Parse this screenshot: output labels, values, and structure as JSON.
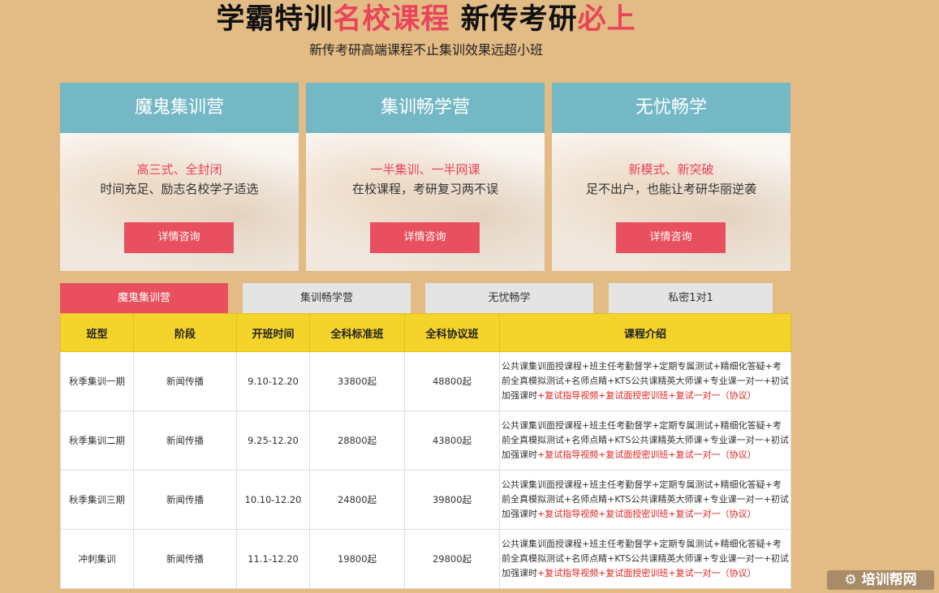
{
  "header": {
    "title_part1": "学霸特训",
    "title_part2": "名校课程",
    "title_part3": " 新传考研",
    "title_part4": "必上",
    "subtitle": "新传考研高端课程不止集训效果远超小班"
  },
  "cards": [
    {
      "title": "魔鬼集训营",
      "line1": "高三式、全封闭",
      "line2": "时间充足、励志名校学子适选",
      "button": "详情咨询"
    },
    {
      "title": "集训畅学营",
      "line1": "一半集训、一半网课",
      "line2": "在校课程，考研复习两不误",
      "button": "详情咨询"
    },
    {
      "title": "无忧畅学",
      "line1": "新模式、新突破",
      "line2": "足不出户，也能让考研华丽逆袭",
      "button": "详情咨询"
    }
  ],
  "tabs": [
    {
      "label": "魔鬼集训营",
      "active": true
    },
    {
      "label": "集训畅学营",
      "active": false
    },
    {
      "label": "无忧畅学",
      "active": false
    },
    {
      "label": "私密1对1",
      "active": false
    }
  ],
  "table": {
    "headers": [
      "班型",
      "阶段",
      "开班时间",
      "全科标准班",
      "全科协议班",
      "课程介绍"
    ],
    "rows": [
      {
        "type": "秋季集训一期",
        "stage": "新闻传播",
        "date": "9.10-12.20",
        "standard": "33800起",
        "protocol": "48800起"
      },
      {
        "type": "秋季集训二期",
        "stage": "新闻传播",
        "date": "9.25-12.20",
        "standard": "28800起",
        "protocol": "43800起"
      },
      {
        "type": "秋季集训三期",
        "stage": "新闻传播",
        "date": "10.10-12.20",
        "standard": "24800起",
        "protocol": "39800起"
      },
      {
        "type": "冲刺集训",
        "stage": "新闻传播",
        "date": "11.1-12.20",
        "standard": "19800起",
        "protocol": "29800起"
      }
    ],
    "intro_normal": "公共课集训面授课程+班主任考勤督学+定期专属测试+精细化答疑+考前全真模拟测试+名师点睛+KTS公共课精英大师课+专业课一对一+初试加强课时",
    "intro_highlight": "+复试指导视频+复试面授密训班+复试一对一（协议）"
  },
  "logo_text": "培训帮网",
  "colors": {
    "accent": "#e9505f",
    "card_header": "#74b8c6",
    "table_header": "#f4d32b",
    "background": "#e2bb85"
  }
}
